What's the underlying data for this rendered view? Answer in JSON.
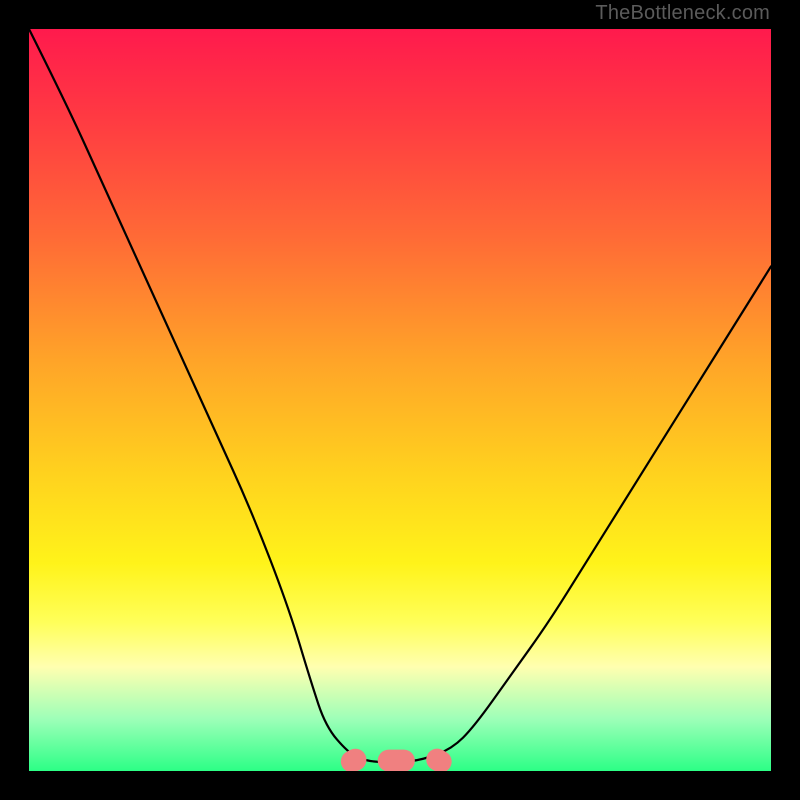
{
  "watermark": "TheBottleneck.com",
  "chart_data": {
    "type": "line",
    "title": "",
    "xlabel": "",
    "ylabel": "",
    "xlim": [
      0,
      100
    ],
    "ylim": [
      0,
      100
    ],
    "series": [
      {
        "name": "bottleneck-curve",
        "x": [
          0,
          5,
          10,
          15,
          20,
          25,
          30,
          35,
          38,
          40,
          43,
          45,
          47,
          50,
          53,
          57,
          60,
          65,
          70,
          75,
          80,
          85,
          90,
          95,
          100
        ],
        "y": [
          100,
          90,
          79,
          68,
          57,
          46,
          35,
          22,
          12,
          6,
          2.5,
          1.5,
          1.2,
          1.2,
          1.5,
          3,
          6,
          13,
          20,
          28,
          36,
          44,
          52,
          60,
          68
        ]
      }
    ],
    "annotations": [
      {
        "name": "trough-marker",
        "shape": "sausage",
        "color": "#f08080",
        "x_range": [
          42,
          57
        ],
        "y": 1.4
      }
    ],
    "gradient_stops": [
      {
        "pos": 0.0,
        "color": "#ff1a4d"
      },
      {
        "pos": 0.28,
        "color": "#ff6a36"
      },
      {
        "pos": 0.6,
        "color": "#ffd21e"
      },
      {
        "pos": 0.8,
        "color": "#ffff5a"
      },
      {
        "pos": 0.93,
        "color": "#9dffb8"
      },
      {
        "pos": 1.0,
        "color": "#2cff86"
      }
    ]
  }
}
